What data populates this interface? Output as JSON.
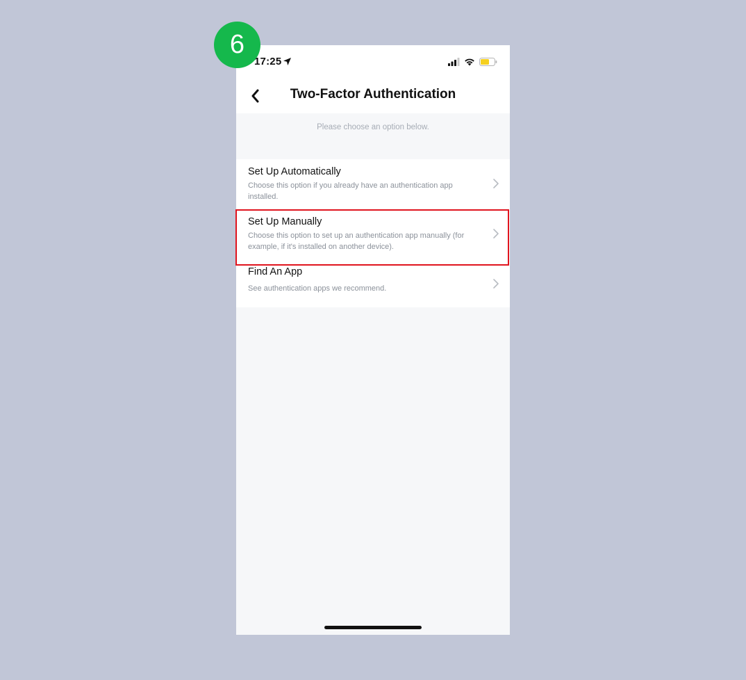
{
  "step_badge": "6",
  "status_bar": {
    "time": "17:25",
    "location_icon": "location-arrow-icon",
    "signal_icon": "cellular-signal-icon",
    "wifi_icon": "wifi-icon",
    "battery_icon": "battery-icon",
    "battery_color": "#f5d020"
  },
  "nav": {
    "title": "Two-Factor Authentication",
    "back_icon": "chevron-left-icon"
  },
  "hint": "Please choose an option below.",
  "options": [
    {
      "title": "Set Up Automatically",
      "description": "Choose this option if you already have an authentication app installed."
    },
    {
      "title": "Set Up Manually",
      "description": "Choose this option to set up an authentication app manually (for example, if it's installed on another device).",
      "highlighted": true
    },
    {
      "title": "Find An App",
      "description": "See authentication apps we recommend."
    }
  ],
  "colors": {
    "highlight": "#e0141e",
    "badge": "#15b84c",
    "background": "#c1c6d7"
  }
}
